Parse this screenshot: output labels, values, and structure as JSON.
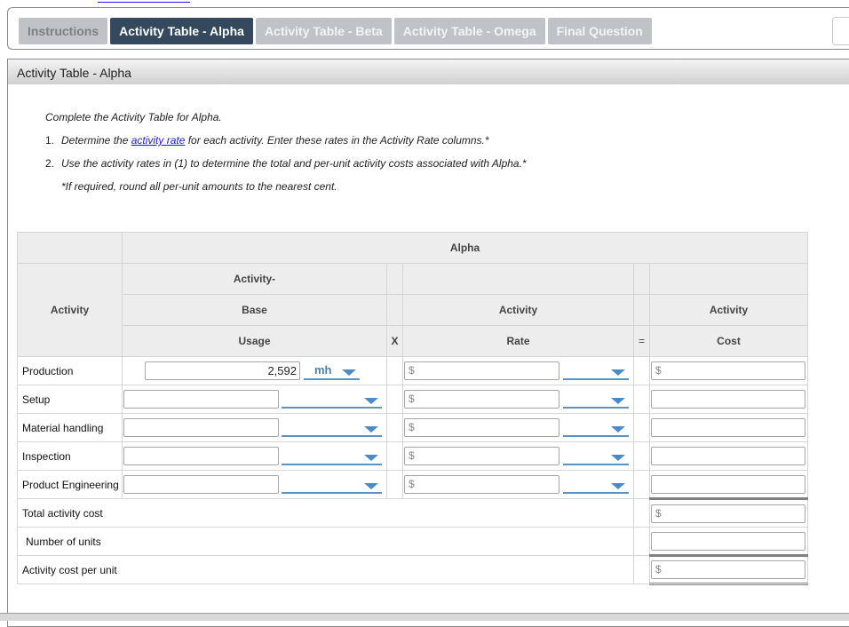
{
  "tabs": [
    {
      "label": "Instructions",
      "active": false
    },
    {
      "label": "Activity Table - Alpha",
      "active": true
    },
    {
      "label": "Activity Table - Beta",
      "active": false
    },
    {
      "label": "Activity Table - Omega",
      "active": false
    },
    {
      "label": "Final Question",
      "active": false
    }
  ],
  "panel": {
    "title": "Activity Table - Alpha",
    "intro": "Complete the Activity Table for Alpha.",
    "step1_num": "1.",
    "step1_pre": "Determine the ",
    "step1_link": "activity rate",
    "step1_post": " for each activity. Enter these rates in the Activity Rate columns.*",
    "step2_num": "2.",
    "step2": "Use the activity rates in (1) to determine the total and per-unit activity costs associated with Alpha.*",
    "note": "*If required, round all per-unit amounts to the nearest cent."
  },
  "table": {
    "group_header": "Alpha",
    "col_activity": "Activity",
    "col_base_line1": "Activity-",
    "col_base_line2": "Base",
    "col_base_line3": "Usage",
    "op_multiply": "X",
    "col_rate_line1": "Activity",
    "col_rate_line2": "Rate",
    "op_equals": "=",
    "col_cost_line1": "Activity",
    "col_cost_line2": "Cost",
    "currency_symbol": "$",
    "rows": [
      {
        "activity": "Production",
        "usage": "2,592",
        "usage_unit": "mh",
        "rate": "",
        "rate_unit": "",
        "cost": ""
      },
      {
        "activity": "Setup",
        "usage": "",
        "usage_unit": "",
        "rate": "",
        "rate_unit": "",
        "cost": ""
      },
      {
        "activity": "Material handling",
        "usage": "",
        "usage_unit": "",
        "rate": "",
        "rate_unit": "",
        "cost": ""
      },
      {
        "activity": "Inspection",
        "usage": "",
        "usage_unit": "",
        "rate": "",
        "rate_unit": "",
        "cost": ""
      },
      {
        "activity": "Product Engineering",
        "usage": "",
        "usage_unit": "",
        "rate": "",
        "rate_unit": "",
        "cost": ""
      }
    ],
    "total_label": "Total activity cost",
    "total_value": "",
    "units_label": "Number of units",
    "units_value": "",
    "per_unit_label": "Activity cost per unit",
    "per_unit_value": ""
  }
}
